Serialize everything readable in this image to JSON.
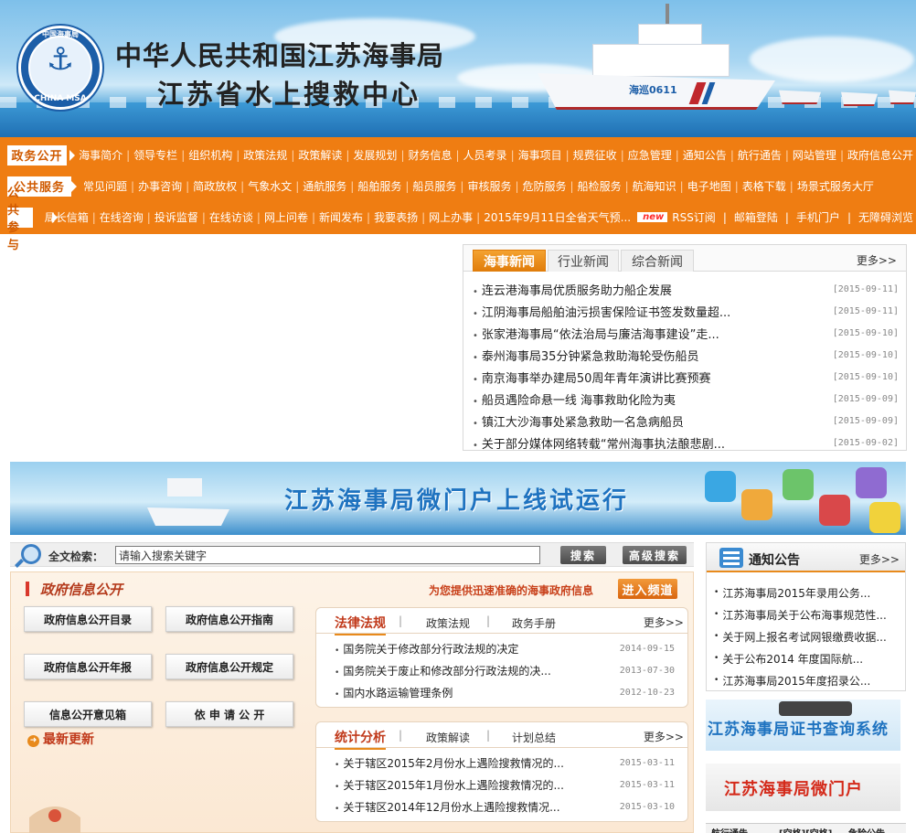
{
  "header": {
    "title_line1": "中华人民共和国江苏海事局",
    "title_line2": "江苏省水上搜救中心",
    "logo_top": "中国海事局",
    "logo_bottom": "CHINA MSA",
    "ship_number": "海巡0611"
  },
  "nav": {
    "rows": [
      {
        "label": "政务公开",
        "items": [
          "海事简介",
          "领导专栏",
          "组织机构",
          "政策法规",
          "政策解读",
          "发展规划",
          "财务信息",
          "人员考录",
          "海事项目",
          "规费征收",
          "应急管理",
          "通知公告",
          "航行通告",
          "网站管理",
          "政府信息公开"
        ]
      },
      {
        "label": "公共服务",
        "items": [
          "常见问题",
          "办事咨询",
          "简政放权",
          "气象水文",
          "通航服务",
          "船舶服务",
          "船员服务",
          "审核服务",
          "危防服务",
          "船检服务",
          "航海知识",
          "电子地图",
          "表格下载",
          "场景式服务大厅"
        ]
      },
      {
        "label": "公共参与",
        "items": [
          "局长信箱",
          "在线咨询",
          "投诉监督",
          "在线访谈",
          "网上问卷",
          "新闻发布",
          "我要表扬",
          "网上办事"
        ]
      }
    ],
    "weather": "2015年9月11日全省天气预...",
    "new_badge": "new",
    "extras": [
      "RSS订阅",
      "邮箱登陆",
      "手机门户",
      "无障碍浏览"
    ]
  },
  "news": {
    "tabs": [
      "海事新闻",
      "行业新闻",
      "综合新闻"
    ],
    "more": "更多>>",
    "items": [
      {
        "title": "连云港海事局优质服务助力船企发展",
        "date": "[2015-09-11]"
      },
      {
        "title": "江阴海事局船舶油污损害保险证书签发数量超...",
        "date": "[2015-09-11]"
      },
      {
        "title": "张家港海事局“依法治局与廉洁海事建设”走...",
        "date": "[2015-09-10]"
      },
      {
        "title": "泰州海事局35分钟紧急救助海轮受伤船员",
        "date": "[2015-09-10]"
      },
      {
        "title": "南京海事举办建局50周年青年演讲比赛预赛",
        "date": "[2015-09-10]"
      },
      {
        "title": "船员遇险命悬一线 海事救助化险为夷",
        "date": "[2015-09-09]"
      },
      {
        "title": "镇江大沙海事处紧急救助一名急病船员",
        "date": "[2015-09-09]"
      },
      {
        "title": "关于部分媒体网络转载“常州海事执法酿悲剧...",
        "date": "[2015-09-02]"
      }
    ]
  },
  "wide_banner": {
    "text": "江苏海事局微门户上线试运行"
  },
  "search": {
    "label": "全文检索：",
    "placeholder": "请输入搜索关键字",
    "search_button": "搜索",
    "advanced_button": "高级搜索"
  },
  "gov": {
    "title": "政府信息公开",
    "subtitle": "为您提供迅速准确的海事政府信息",
    "enter": "进入频道",
    "buttons": [
      "政府信息公开目录",
      "政府信息公开指南",
      "政府信息公开年报",
      "政府信息公开规定",
      "信息公开意见箱",
      "依 申 请 公 开"
    ],
    "latest": "最新更新",
    "law": {
      "tabs": [
        "法律法规",
        "政策法规",
        "政务手册"
      ],
      "more": "更多>>",
      "items": [
        {
          "title": "国务院关于修改部分行政法规的决定",
          "date": "2014-09-15"
        },
        {
          "title": "国务院关于废止和修改部分行政法规的决...",
          "date": "2013-07-30"
        },
        {
          "title": "国内水路运输管理条例",
          "date": "2012-10-23"
        }
      ]
    },
    "stats": {
      "tabs": [
        "统计分析",
        "政策解读",
        "计划总结"
      ],
      "more": "更多>>",
      "items": [
        {
          "title": "关于辖区2015年2月份水上遇险搜救情况的...",
          "date": "2015-03-11"
        },
        {
          "title": "关于辖区2015年1月份水上遇险搜救情况的...",
          "date": "2015-03-11"
        },
        {
          "title": "关于辖区2014年12月份水上遇险搜救情况...",
          "date": "2015-03-10"
        }
      ]
    }
  },
  "notice": {
    "title": "通知公告",
    "more": "更多>>",
    "items": [
      "江苏海事局2015年录用公务...",
      "江苏海事局关于公布海事规范性...",
      "关于网上报名考试网银缴费收据...",
      "关于公布2014 年度国际航...",
      "江苏海事局2015年度招录公..."
    ]
  },
  "side": {
    "cert_query": "江苏海事局证书查询系统",
    "micro_portal": "江苏海事局微门户"
  },
  "bottom_tabs": [
    "航行通告",
    "[空格][空格]",
    "危险公告"
  ],
  "colors": {
    "accent": "#ef7d12",
    "link_red": "#c0391a",
    "blue": "#1f73c0"
  }
}
